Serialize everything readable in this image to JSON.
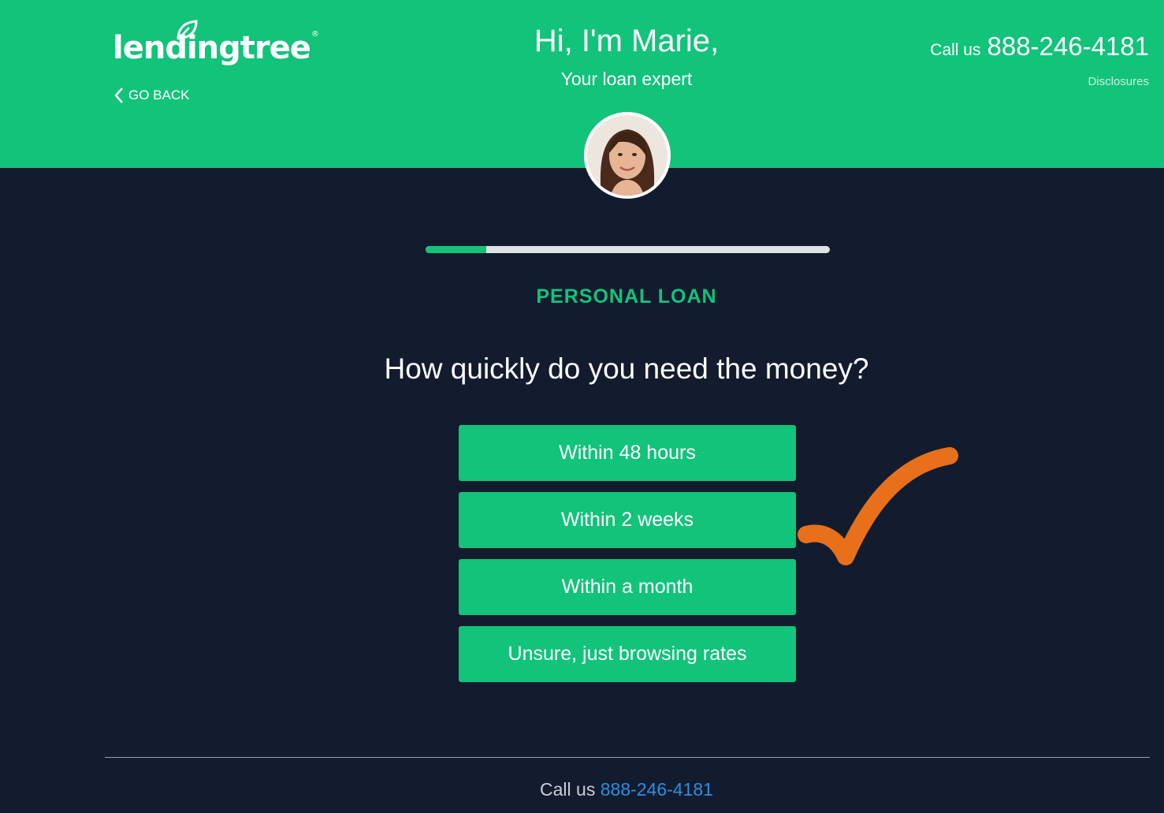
{
  "header": {
    "logo_text": "lendingtree",
    "logo_mark": "®",
    "go_back_label": "GO BACK",
    "greeting": "Hi, I'm Marie,",
    "subtitle": "Your loan expert",
    "call_label": "Call us",
    "phone": "888-246-4181",
    "disclosures_label": "Disclosures"
  },
  "progress": {
    "fraction": 0.15
  },
  "form": {
    "eyebrow": "PERSONAL LOAN",
    "question": "How quickly do you need the money?",
    "options": [
      {
        "label": "Within 48 hours"
      },
      {
        "label": "Within 2 weeks"
      },
      {
        "label": "Within a month"
      },
      {
        "label": "Unsure, just browsing rates"
      }
    ]
  },
  "footer": {
    "call_label": "Call us",
    "phone": "888-246-4181"
  },
  "colors": {
    "brand_green": "#12c37a",
    "background": "#131c2e",
    "annotation_orange": "#e8701a",
    "link_blue": "#2f8de0"
  }
}
